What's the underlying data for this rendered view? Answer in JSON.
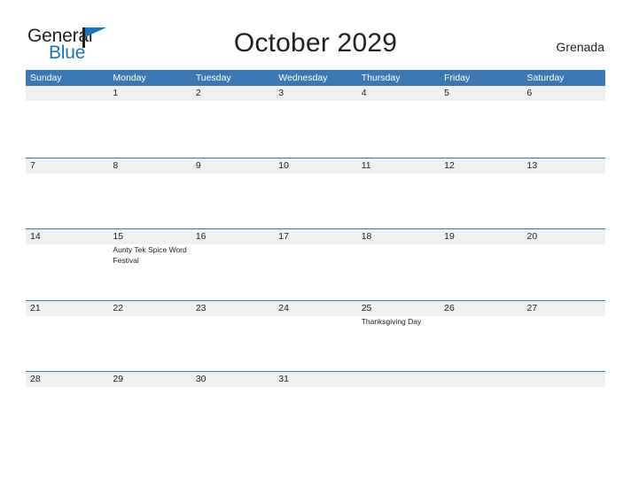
{
  "brand": {
    "name_part1": "General",
    "name_part2": "Blue",
    "triangle_icon": "triangle-right-icon",
    "accent_color": "#1b75bb"
  },
  "header": {
    "title": "October 2029",
    "country": "Grenada"
  },
  "theme": {
    "header_blue": "#3a78b5",
    "date_band_gray": "#f0f0f0",
    "text_color": "#231f20",
    "page_background": "#ffffff"
  },
  "calendar": {
    "month": "October",
    "year": "2029",
    "weekday_headers": [
      "Sunday",
      "Monday",
      "Tuesday",
      "Wednesday",
      "Thursday",
      "Friday",
      "Saturday"
    ],
    "weeks": [
      {
        "days": [
          {
            "date": "",
            "events": []
          },
          {
            "date": "1",
            "events": []
          },
          {
            "date": "2",
            "events": []
          },
          {
            "date": "3",
            "events": []
          },
          {
            "date": "4",
            "events": []
          },
          {
            "date": "5",
            "events": []
          },
          {
            "date": "6",
            "events": []
          }
        ]
      },
      {
        "days": [
          {
            "date": "7",
            "events": []
          },
          {
            "date": "8",
            "events": []
          },
          {
            "date": "9",
            "events": []
          },
          {
            "date": "10",
            "events": []
          },
          {
            "date": "11",
            "events": []
          },
          {
            "date": "12",
            "events": []
          },
          {
            "date": "13",
            "events": []
          }
        ]
      },
      {
        "days": [
          {
            "date": "14",
            "events": []
          },
          {
            "date": "15",
            "events": [
              "Aunty Tek Spice Word Festival"
            ]
          },
          {
            "date": "16",
            "events": []
          },
          {
            "date": "17",
            "events": []
          },
          {
            "date": "18",
            "events": []
          },
          {
            "date": "19",
            "events": []
          },
          {
            "date": "20",
            "events": []
          }
        ]
      },
      {
        "days": [
          {
            "date": "21",
            "events": []
          },
          {
            "date": "22",
            "events": []
          },
          {
            "date": "23",
            "events": []
          },
          {
            "date": "24",
            "events": []
          },
          {
            "date": "25",
            "events": [
              "Thanksgiving Day"
            ]
          },
          {
            "date": "26",
            "events": []
          },
          {
            "date": "27",
            "events": []
          }
        ]
      },
      {
        "days": [
          {
            "date": "28",
            "events": []
          },
          {
            "date": "29",
            "events": []
          },
          {
            "date": "30",
            "events": []
          },
          {
            "date": "31",
            "events": []
          },
          {
            "date": "",
            "events": []
          },
          {
            "date": "",
            "events": []
          },
          {
            "date": "",
            "events": []
          }
        ]
      }
    ]
  }
}
